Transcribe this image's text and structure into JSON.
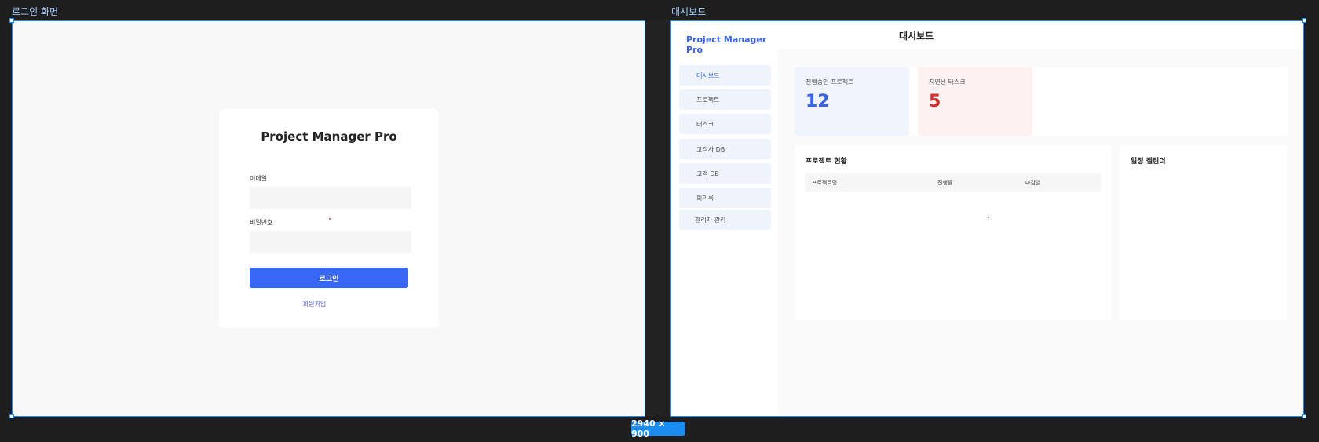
{
  "canvas": {
    "login_frame_label": "로그인 화면",
    "dashboard_frame_label": "대시보드",
    "size_badge": "2940 × 900",
    "accent_color": "#1b8cf0"
  },
  "login": {
    "title": "Project Manager Pro",
    "email_label": "이메일",
    "password_label": "비밀번호",
    "email_value": "",
    "password_value": "",
    "login_button": "로그인",
    "signup_link": "회원가입",
    "button_color": "#3866f5"
  },
  "dashboard": {
    "brand": "Project Manager Pro",
    "page_title": "대시보드",
    "nav": [
      {
        "label": "대시보드",
        "active": true
      },
      {
        "label": "프로젝트",
        "active": false
      },
      {
        "label": "태스크",
        "active": false
      },
      {
        "label": "고객사 DB",
        "active": false
      },
      {
        "label": "고객 DB",
        "active": false
      },
      {
        "label": "회의록",
        "active": false
      },
      {
        "label": "관리자 관리",
        "active": false
      }
    ],
    "stats": [
      {
        "label": "진행중인 프로젝트",
        "value": "12",
        "color": "#3a63e8",
        "bg": "#f0f5fd"
      },
      {
        "label": "지연된 태스크",
        "value": "5",
        "color": "#d32f2f",
        "bg": "#fdf1f1"
      }
    ],
    "projects_panel": {
      "title": "프로젝트 현황",
      "columns": [
        "프로젝트명",
        "진행률",
        "마감일"
      ]
    },
    "calendar_panel": {
      "title": "일정 캘린더"
    }
  }
}
